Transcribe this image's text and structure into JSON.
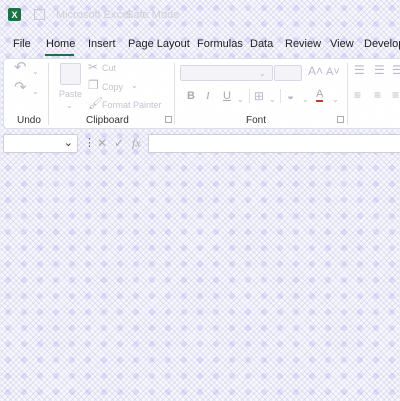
{
  "window": {
    "app_title": "Microsoft Excel",
    "document_title": "Safe Mode",
    "logo_letter": "X"
  },
  "tabs": [
    "File",
    "Home",
    "Insert",
    "Page Layout",
    "Formulas",
    "Data",
    "Review",
    "View",
    "Developer"
  ],
  "active_tab": "Home",
  "ribbon": {
    "undo_group": {
      "label": "Undo"
    },
    "clipboard_group": {
      "label": "Clipboard",
      "paste": "Paste",
      "cut": "Cut",
      "copy": "Copy",
      "format_painter": "Format Painter"
    },
    "font_group": {
      "label": "Font",
      "bold": "B",
      "italic": "I",
      "underline": "U",
      "font_color_letter": "A"
    }
  },
  "formula_bar": {
    "name_box_value": "",
    "formula_value": "",
    "fx_label": "fx"
  },
  "colors": {
    "accent": "#1e7145",
    "background_pattern": "#d9d9f3"
  }
}
